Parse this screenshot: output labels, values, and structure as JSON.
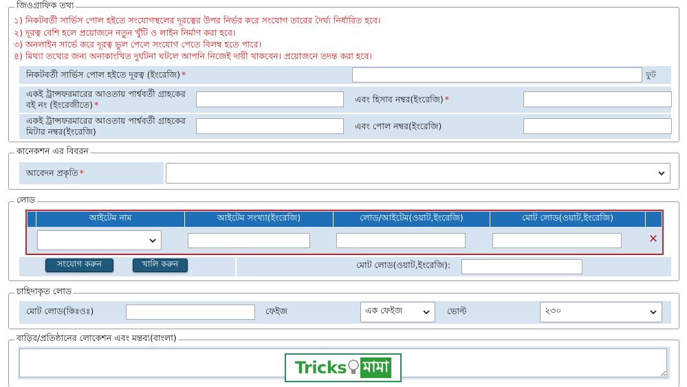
{
  "geo": {
    "legend": "জিওগ্রাফিক তথ্য",
    "notes": [
      "১) নিকটবর্তী সার্ভিস পোল হইতে সংযোগস্থলের দূরত্বের উপর নির্ভর করে সংযোগ তারের দৈর্ঘ্য নির্ধারিত হবে।",
      "২) দূরত্ব বেশি হলে প্রয়োজনে নতুন খুঁটি ও লাইন নির্মাণ করা হবে।",
      "৩) অনলাইন সার্ভে করে দূরত্ব ভুল পেলে সংযোগ পেতে বিলম্ব হতে পারে।",
      "৪) মিথ্যা তথ্যের জন্য অনাকাংখিত দুর্ঘটনা ঘটলে আপনি নিজেই দায়ী থাকবেন। প্রয়োজনে তদন্ত করা হবে।"
    ],
    "distance_label": "নিকটবর্তী সার্ভিস পোল হইতে দূরত্ব (ইংরেজি)",
    "distance_unit": "ফুট",
    "book_label": "একই ট্রান্সফরমারের আওতায় পার্শ্ববর্তী গ্রাহকের বই নং (ইংরেজীতে)",
    "account_label": "এবং হিসাব নম্বর(ইংরেজি)",
    "meter_label": "একই ট্রান্সফরমারের আওতায় পার্শ্ববর্তী গ্রাহকের মিটার নম্বর(ইংরেজি)",
    "pole_label": "এবং পোল নম্বর(ইংরেজি)",
    "required_mark": "*"
  },
  "connection": {
    "legend": "কানেকশন এর বিবরন",
    "apply_type_label": "আবেদন প্রকৃতি",
    "apply_type_value": ""
  },
  "load": {
    "legend": "লোড",
    "headers": [
      "আইটেম নাম",
      "আইটেম সংখ্যা(ইংরেজি)",
      "লোড/আইটেম(ওয়াট,ইংরেজি)",
      "মোট লোড(ওয়াট,ইংরেজি)"
    ],
    "item_select_value": "",
    "add_button": "সংযোগ করুন",
    "clear_button": "খালি করুন",
    "total_label": "মোট লোড(ওয়াট,ইংরেজি):",
    "remove_icon": "✕",
    "accent_color": "#c0272d",
    "header_color": "#1d6fb8"
  },
  "demand": {
    "legend": "চাহিদাকৃত লোড",
    "total_label": "মোট লোড(কিঃওঃ)",
    "phase_label": "ফেইজ",
    "phase_value": "এক ফেইজ",
    "volt_label": "ভোল্ট",
    "volt_value": "২৩০"
  },
  "location": {
    "legend": "বাড়ির/প্রতিষ্ঠানের লোকেশন এবং মন্তব্য(বাংলা)"
  },
  "watermark": {
    "left": "Tricks",
    "right": "মামা"
  }
}
